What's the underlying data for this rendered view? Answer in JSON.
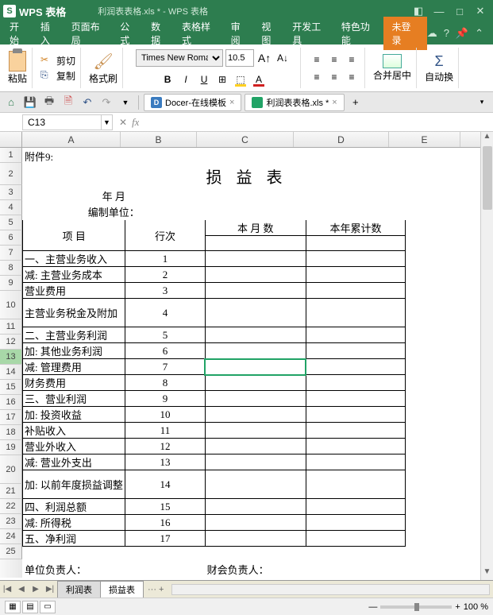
{
  "titlebar": {
    "app": "WPS 表格",
    "file": "利润表表格.xls * - WPS 表格"
  },
  "menubar": {
    "items": [
      "开始",
      "插入",
      "页面布局",
      "公式",
      "数据",
      "表格样式",
      "审阅",
      "视图",
      "开发工具",
      "特色功能"
    ],
    "login": "未登录"
  },
  "ribbon": {
    "paste": "粘贴",
    "cut": "剪切",
    "copy": "复制",
    "format_painter": "格式刷",
    "font_name": "Times New Roman",
    "font_size": "10.5",
    "merge": "合并居中",
    "auto": "自动换"
  },
  "tabs": {
    "docer": "Docer-在线模板",
    "current": "利润表表格.xls *"
  },
  "namebox": {
    "cell": "C13"
  },
  "grid": {
    "cols": [
      "A",
      "B",
      "C",
      "D",
      "E"
    ],
    "attachment": "附件9:",
    "title": "损益表",
    "year_month": "年      月",
    "unit_label": "编制单位：",
    "hdr_item": "项      目",
    "hdr_line": "行次",
    "hdr_month": "本 月 数",
    "hdr_year": "本年累计数",
    "rows": [
      {
        "n": "7",
        "a": "一、主营业务收入",
        "b": "1"
      },
      {
        "n": "8",
        "a": "减: 主营业务成本",
        "b": "2"
      },
      {
        "n": "9",
        "a": "营业费用",
        "b": "3"
      },
      {
        "n": "10",
        "a": "主营业务税金及附加",
        "b": "4",
        "tall": true
      },
      {
        "n": "11",
        "a": "二、主营业务利润",
        "b": "5"
      },
      {
        "n": "12",
        "a": "加: 其他业务利润",
        "b": "6"
      },
      {
        "n": "13",
        "a": "减: 管理费用",
        "b": "7",
        "sel": true
      },
      {
        "n": "14",
        "a": "财务费用",
        "b": "8"
      },
      {
        "n": "15",
        "a": "三、营业利润",
        "b": "9"
      },
      {
        "n": "16",
        "a": "加: 投资收益",
        "b": "10"
      },
      {
        "n": "17",
        "a": "补贴收入",
        "b": "11"
      },
      {
        "n": "18",
        "a": "营业外收入",
        "b": "12"
      },
      {
        "n": "19",
        "a": "减: 营业外支出",
        "b": "13"
      },
      {
        "n": "20",
        "a": "加: 以前年度损益调整",
        "b": "14",
        "tall": true
      },
      {
        "n": "21",
        "a": "四、利润总额",
        "b": "15"
      },
      {
        "n": "22",
        "a": "减: 所得税",
        "b": "16"
      },
      {
        "n": "23",
        "a": "五、净利润",
        "b": "17"
      }
    ],
    "footer_unit": "单位负责人：",
    "footer_acct": "财会负责人："
  },
  "sheets": {
    "tabs": [
      "利润表",
      "损益表"
    ],
    "active": 1
  },
  "status": {
    "zoom": "100 %"
  }
}
